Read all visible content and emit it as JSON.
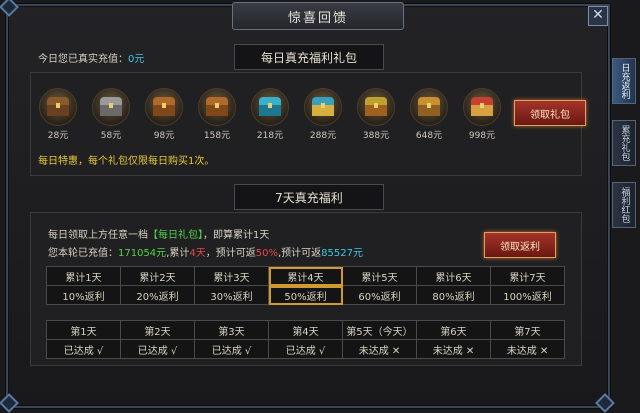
{
  "window": {
    "title": "惊喜回馈",
    "close_label": "✕"
  },
  "daily": {
    "section_title": "每日真充福利礼包",
    "recharge_prefix": "今日您已真实充值：",
    "recharge_value": "0元",
    "chests": [
      {
        "label": "28元",
        "lid": "#8a5a2a",
        "base": "#6a4020"
      },
      {
        "label": "58元",
        "lid": "#9a9a9a",
        "base": "#6a6a6a"
      },
      {
        "label": "98元",
        "lid": "#b06a2a",
        "base": "#804818"
      },
      {
        "label": "158元",
        "lid": "#b06a2a",
        "base": "#804818"
      },
      {
        "label": "218元",
        "lid": "#3ab0c8",
        "base": "#1a7890"
      },
      {
        "label": "288元",
        "lid": "#3aa0c0",
        "base": "#d8b040"
      },
      {
        "label": "388元",
        "lid": "#c0a030",
        "base": "#a06020"
      },
      {
        "label": "648元",
        "lid": "#c89030",
        "base": "#906020"
      },
      {
        "label": "998元",
        "lid": "#c84030",
        "base": "#d8a040"
      }
    ],
    "claim_button": "领取礼包",
    "special_note": "每日特惠，每个礼包仅限每日购买1次。"
  },
  "seven": {
    "section_title": "7天真充福利",
    "line1_a": "每日领取上方任意一档",
    "line1_b": "【每日礼包】",
    "line1_c": "，即算累计1天",
    "line2_a": "您本轮已充值：",
    "line2_b": "171054元",
    "line2_c": ",累计",
    "line2_d": "4天",
    "line2_e": "，预计可返",
    "line2_f": "50%",
    "line2_g": ",预计可返",
    "line2_h": "85527元",
    "claim_button": "领取返利",
    "cumulative": [
      "累计1天",
      "累计2天",
      "累计3天",
      "累计4天",
      "累计5天",
      "累计6天",
      "累计7天"
    ],
    "rebates": [
      "10%返利",
      "20%返利",
      "30%返利",
      "50%返利",
      "60%返利",
      "80%返利",
      "100%返利"
    ],
    "days": [
      "第1天",
      "第2天",
      "第3天",
      "第4天",
      "第5天（今天）",
      "第6天",
      "第7天"
    ],
    "status": [
      "已达成 √",
      "已达成 √",
      "已达成 √",
      "已达成 √",
      "未达成 ✕",
      "未达成 ✕",
      "未达成 ✕"
    ]
  },
  "side_tabs": [
    "日充返利",
    "累充礼包",
    "福利红包"
  ]
}
